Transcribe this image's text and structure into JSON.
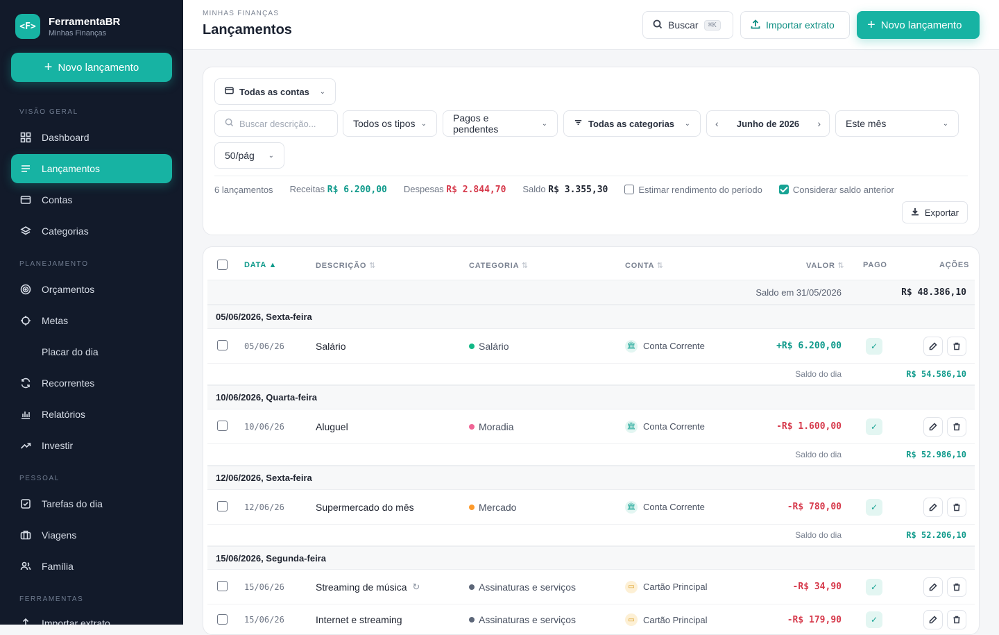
{
  "sidebar": {
    "logo": "<F>",
    "brand": "FerramentaBR",
    "brand_sub": "Minhas Finanças",
    "new_button": "Novo lançamento",
    "sections": {
      "overview": "VISÃO GERAL",
      "planning": "PLANEJAMENTO",
      "personal": "PESSOAL",
      "tools": "FERRAMENTAS"
    },
    "items": {
      "dashboard": "Dashboard",
      "lancamentos": "Lançamentos",
      "contas": "Contas",
      "categorias": "Categorias",
      "orcamentos": "Orçamentos",
      "metas": "Metas",
      "placar": "Placar do dia",
      "recorrentes": "Recorrentes",
      "relatorios": "Relatórios",
      "investir": "Investir",
      "tarefas": "Tarefas do dia",
      "viagens": "Viagens",
      "familia": "Família",
      "importar": "Importar extrato"
    }
  },
  "header": {
    "eyebrow": "MINHAS FINANÇAS",
    "title": "Lançamentos",
    "search_label": "Buscar",
    "search_shortcut": "⌘K",
    "import_label": "Importar extrato",
    "new_label": "Novo lançamento"
  },
  "filters": {
    "accounts": "Todas as contas",
    "search_placeholder": "Buscar descrição...",
    "types": "Todos os tipos",
    "status": "Pagos e pendentes",
    "categories": "Todas as categorias",
    "month": "Junho de 2026",
    "period": "Este mês",
    "per_page": "50/pág"
  },
  "summary": {
    "count": "6 lançamentos",
    "income_label": "Receitas",
    "income_value": "R$ 6.200,00",
    "expense_label": "Despesas",
    "expense_value": "R$ 2.844,70",
    "balance_label": "Saldo",
    "balance_value": "R$ 3.355,30",
    "estimate_label": "Estimar rendimento do período",
    "consider_label": "Considerar saldo anterior",
    "export_label": "Exportar"
  },
  "table": {
    "headers": {
      "date": "DATA ▲",
      "description": "DESCRIÇÃO",
      "category": "CATEGORIA",
      "account": "CONTA",
      "value": "VALOR",
      "paid": "PAGO",
      "actions": "AÇÕES"
    },
    "opening_label": "Saldo em 31/05/2026",
    "opening_value": "R$ 48.386,10",
    "day_balance_label": "Saldo do dia",
    "groups": [
      {
        "title": "05/06/2026, Sexta-feira",
        "day_balance": "R$ 54.586,10"
      },
      {
        "title": "10/06/2026, Quarta-feira",
        "day_balance": "R$ 52.986,10"
      },
      {
        "title": "12/06/2026, Sexta-feira",
        "day_balance": "R$ 52.206,10"
      },
      {
        "title": "15/06/2026, Segunda-feira",
        "day_balance": ""
      }
    ],
    "rows": [
      {
        "date": "05/06/26",
        "desc": "Salário",
        "category": "Salário",
        "cat_color": "#12b886",
        "account": "Conta Corrente",
        "value": "+R$ 6.200,00"
      },
      {
        "date": "10/06/26",
        "desc": "Aluguel",
        "category": "Moradia",
        "cat_color": "#f06595",
        "account": "Conta Corrente",
        "value": "-R$ 1.600,00"
      },
      {
        "date": "12/06/26",
        "desc": "Supermercado do mês",
        "category": "Mercado",
        "cat_color": "#fd9a2b",
        "account": "Conta Corrente",
        "value": "-R$ 780,00"
      },
      {
        "date": "15/06/26",
        "desc": "Streaming de música",
        "category": "Assinaturas e serviços",
        "cat_color": "#5c6678",
        "account": "Cartão Principal",
        "value": "-R$ 34,90"
      },
      {
        "date": "15/06/26",
        "desc": "Internet e streaming",
        "category": "Assinaturas e serviços",
        "cat_color": "#5c6678",
        "account": "Cartão Principal",
        "value": "-R$ 179,90"
      }
    ]
  },
  "colors": {
    "accent": "#17b3a3",
    "sidebar": "#121a2a",
    "income": "#0f9a8b",
    "expense": "#d6394b"
  }
}
